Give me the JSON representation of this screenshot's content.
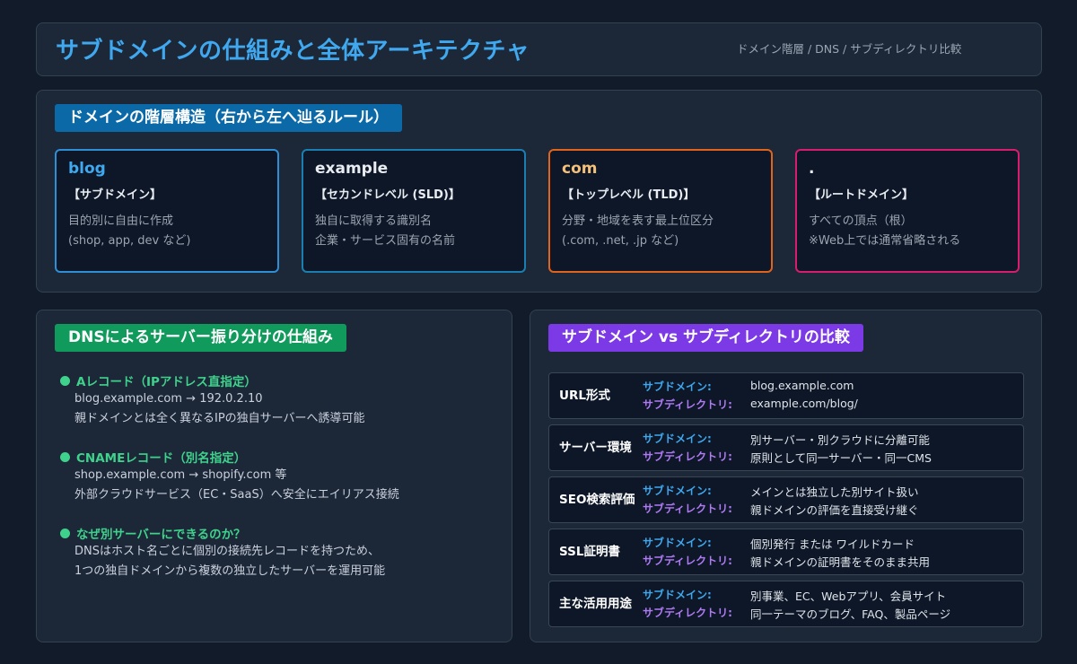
{
  "header": {
    "title": "サブドメインの仕組みと全体アーキテクチャ",
    "subtitle": "ドメイン階層 / DNS / サブディレクトリ比較"
  },
  "hierarchy": {
    "title": "ドメインの階層構造（右から左へ辿るルール）",
    "cards": [
      {
        "name": "blog",
        "kind": "【サブドメイン】",
        "desc1": "目的別に自由に作成",
        "desc2": "(shop, app, dev など)",
        "color": "#2f8fd6",
        "name_color": "#3fa8ee"
      },
      {
        "name": "example",
        "kind": "【セカンドレベル (SLD)】",
        "desc1": "独自に取得する識別名",
        "desc2": "企業・サービス固有の名前",
        "color": "#1a7fb0",
        "name_color": "#e9edf2"
      },
      {
        "name": "com",
        "kind": "【トップレベル (TLD)】",
        "desc1": "分野・地域を表す最上位区分",
        "desc2": "(.com, .net, .jp など)",
        "color": "#e0641c",
        "name_color": "#f5c07a"
      },
      {
        "name": ".",
        "kind": "【ルートドメイン】",
        "desc1": "すべての頂点（根）",
        "desc2": "※Web上では通常省略される",
        "color": "#d81c6e",
        "name_color": "#e9edf2"
      }
    ]
  },
  "dns": {
    "title": "DNSによるサーバー振り分けの仕組み",
    "items": [
      {
        "head": "Aレコード（IPアドレス直指定）",
        "line1": "blog.example.com → 192.0.2.10",
        "line2": "親ドメインとは全く異なるIPの独自サーバーへ誘導可能"
      },
      {
        "head": "CNAMEレコード（別名指定）",
        "line1": "shop.example.com → shopify.com 等",
        "line2": "外部クラウドサービス（EC・SaaS）へ安全にエイリアス接続"
      },
      {
        "head": "なぜ別サーバーにできるのか？",
        "line1": "DNSはホスト名ごとに個別の接続先レコードを持つため、",
        "line2": "1つの独自ドメインから複数の独立したサーバーを運用可能"
      }
    ]
  },
  "compare": {
    "title": "サブドメイン vs サブディレクトリの比較",
    "sub_label": "サブドメイン:",
    "dir_label": "サブディレクトリ:",
    "rows": [
      {
        "label": "URL形式",
        "sub": "blog.example.com",
        "dir": "example.com/blog/"
      },
      {
        "label": "サーバー環境",
        "sub": "別サーバー・別クラウドに分離可能",
        "dir": "原則として同一サーバー・同一CMS"
      },
      {
        "label": "SEO検索評価",
        "sub": "メインとは独立した別サイト扱い",
        "dir": "親ドメインの評価を直接受け継ぐ"
      },
      {
        "label": "SSL証明書",
        "sub": "個別発行 または ワイルドカード",
        "dir": "親ドメインの証明書をそのまま共用"
      },
      {
        "label": "主な活用用途",
        "sub": "別事業、EC、Webアプリ、会員サイト",
        "dir": "同一テーマのブログ、FAQ、製品ページ"
      }
    ]
  }
}
